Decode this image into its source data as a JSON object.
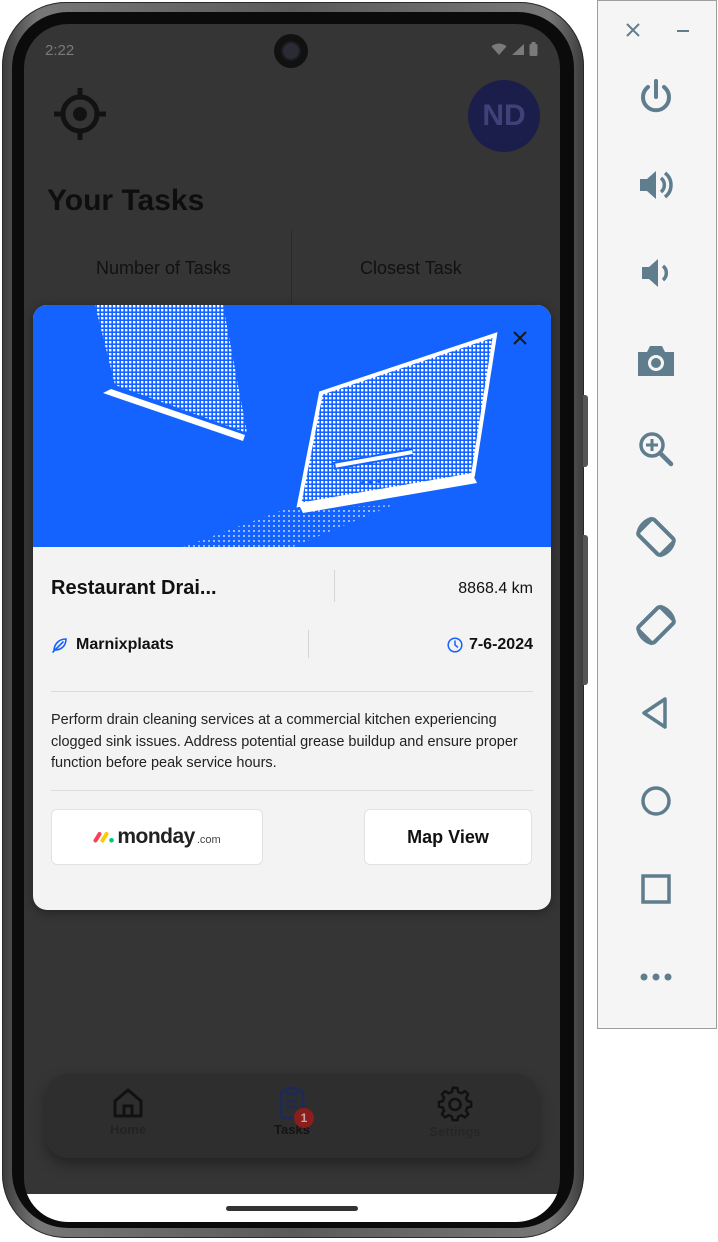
{
  "status": {
    "time": "2:22"
  },
  "header": {
    "avatar_initials": "ND",
    "title": "Your Tasks"
  },
  "stats": {
    "number_of_tasks_label": "Number of Tasks",
    "closest_task_label": "Closest Task"
  },
  "modal": {
    "title": "Restaurant Drai...",
    "distance": "8868.4 km",
    "location": "Marnixplaats",
    "date": "7-6-2024",
    "description": "Perform drain cleaning services at a commercial kitchen experiencing clogged sink issues. Address potential grease buildup and ensure proper function before peak service hours.",
    "monday_logo_word": "monday",
    "monday_logo_suffix": ".com",
    "map_view_label": "Map View"
  },
  "nav": {
    "items": [
      {
        "label": "Home",
        "icon": "home-icon"
      },
      {
        "label": "Tasks",
        "icon": "clipboard-icon",
        "badge": "1",
        "active": true
      },
      {
        "label": "Settings",
        "icon": "gear-icon"
      }
    ]
  },
  "colors": {
    "accent": "#1463ff",
    "backdrop": "#353535",
    "modal_bg": "#f3f3f3",
    "badge": "#8b1d1d",
    "panel_icon": "#5f7d8c"
  },
  "emulator_panel": {
    "buttons": [
      "close-icon",
      "minimize-icon",
      "power-icon",
      "volume-up-icon",
      "volume-down-icon",
      "camera-icon",
      "zoom-icon",
      "rotate-left-icon",
      "rotate-right-icon",
      "back-icon",
      "home-icon",
      "overview-icon",
      "more-icon"
    ]
  }
}
